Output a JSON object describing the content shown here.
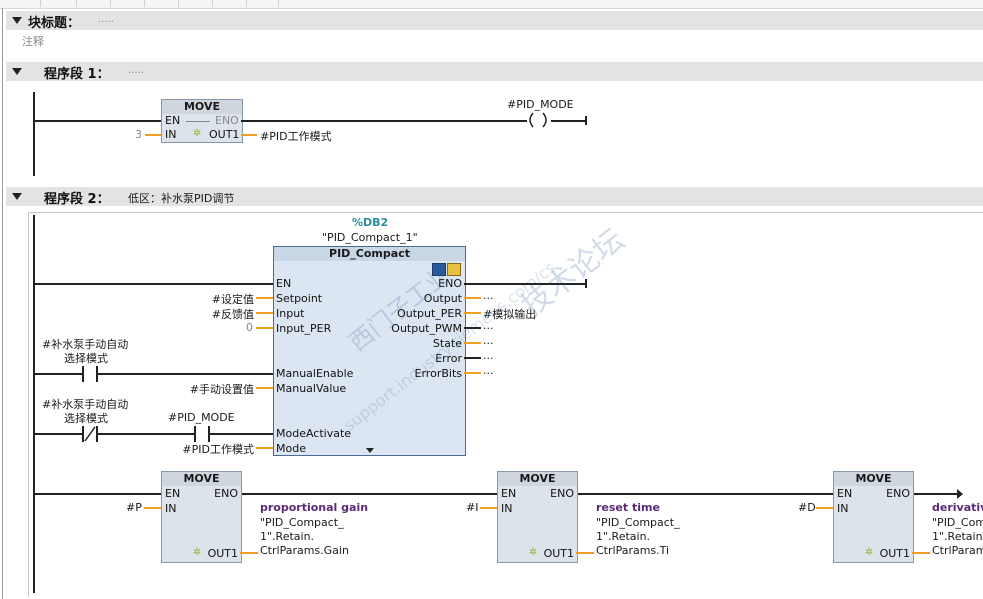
{
  "block": {
    "title_label": "块标题：",
    "title_value": ".....",
    "comment": "注释"
  },
  "network1": {
    "label": "程序段 1：",
    "comment": ".....",
    "move": {
      "name": "MOVE",
      "en": "EN",
      "eno": "ENO",
      "in": "IN",
      "out": "OUT1",
      "in_value": "3",
      "out_var": "#PID工作模式"
    },
    "coil_var": "#PID_MODE"
  },
  "network2": {
    "label": "程序段 2：",
    "comment": "低区：补水泵PID调节",
    "pid": {
      "db": "%DB2",
      "instance": "\"PID_Compact_1\"",
      "name": "PID_Compact",
      "inputs": [
        "EN",
        "Setpoint",
        "Input",
        "Input_PER",
        "ManualEnable",
        "ManualValue",
        "ModeActivate",
        "Mode"
      ],
      "outputs": [
        "ENO",
        "Output",
        "Output_PER",
        "Output_PWM",
        "State",
        "Error",
        "ErrorBits"
      ],
      "setpoint_var": "#设定值",
      "input_var": "#反馈值",
      "input_per_value": "0",
      "manualvalue_var": "#手动设置值",
      "mode_var": "#PID工作模式",
      "output_per_var": "#模拟输出",
      "dots": "..."
    },
    "contact1": {
      "line1": "#补水泵手动自动",
      "line2": "选择模式"
    },
    "contact2": {
      "line1": "#补水泵手动自动",
      "line2": "选择模式"
    },
    "contact3": {
      "var": "#PID_MODE"
    },
    "moves": [
      {
        "name": "MOVE",
        "en": "EN",
        "eno": "ENO",
        "in": "IN",
        "out": "OUT1",
        "in_var": "#P",
        "label": "proportional gain",
        "dest1": "\"PID_Compact_",
        "dest2": "1\".Retain.",
        "dest3": "CtrlParams.Gain"
      },
      {
        "name": "MOVE",
        "en": "EN",
        "eno": "ENO",
        "in": "IN",
        "out": "OUT1",
        "in_var": "#I",
        "label": "reset time",
        "dest1": "\"PID_Compact_",
        "dest2": "1\".Retain.",
        "dest3": "CtrlParams.Ti"
      },
      {
        "name": "MOVE",
        "en": "EN",
        "eno": "ENO",
        "in": "IN",
        "out": "OUT1",
        "in_var": "#D",
        "label": "derivative",
        "dest1": "\"PID_Com",
        "dest2": "1\".Retain.",
        "dest3": "CtrlParam"
      }
    ]
  },
  "colors": {
    "header_bar": "#e3e3e3",
    "pid_block": "#dbe6f2",
    "move_block": "#dde3ea",
    "pin_wire": "#f0a020",
    "db_label": "#2a8f9a",
    "comment_label": "#5b2b7a"
  },
  "watermark": {
    "line1": "西门子工业",
    "line2": "技术论坛",
    "line3": "support.industry.siemens.com/cs"
  }
}
